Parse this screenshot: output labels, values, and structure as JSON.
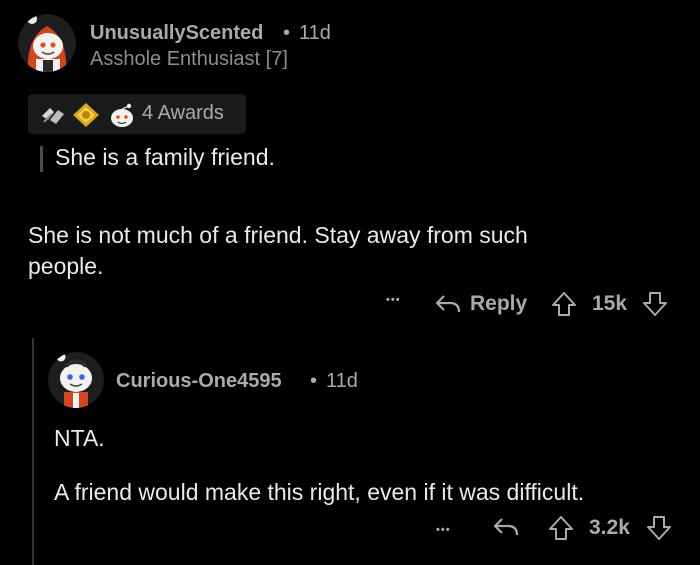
{
  "comment1": {
    "username": "UnusuallyScented",
    "separator": "•",
    "time": "11d",
    "flair": "Asshole Enthusiast [7]",
    "awards_label": "4 Awards",
    "quote": "She is a family friend.",
    "body_line1": "She is not much of a friend. Stay away from such",
    "body_line2": "people.",
    "more": "•••",
    "reply_label": "Reply",
    "score": "15k"
  },
  "comment2": {
    "username": "Curious-One4595",
    "separator": "•",
    "time": "11d",
    "body_line1": "NTA.",
    "body_line2": "A friend would make this right, even if it was difficult.",
    "more": "•••",
    "score": "3.2k"
  },
  "icons": {
    "avatar1": "snoo-avatar-orange-hood",
    "avatar2": "snoo-avatar-white",
    "awards": [
      "helpful-hands-award",
      "gold-award",
      "wholesome-award"
    ],
    "reply": "reply-arrow-icon",
    "upvote": "upvote-arrow-icon",
    "downvote": "downvote-arrow-icon"
  },
  "colors": {
    "background": "#000000",
    "text": "#e8eaeb",
    "meta": "#a8aaab",
    "awards_bg": "#1a1a1b",
    "thread_line": "#343536"
  }
}
